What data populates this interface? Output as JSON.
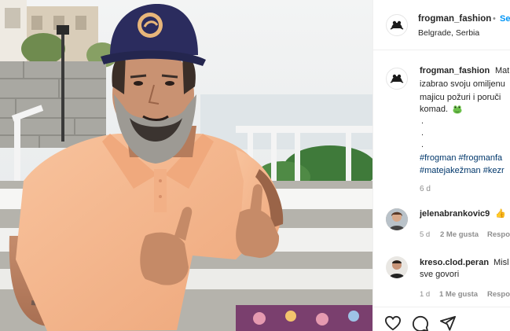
{
  "header": {
    "username": "frogman_fashion",
    "dot": "•",
    "follow": "Se",
    "location": "Belgrade, Serbia"
  },
  "caption": {
    "username": "frogman_fashion",
    "line1_end": "Mat",
    "line2": "izabrao svoju omiljenu",
    "line3": "majicu požuri i poruči",
    "line4": "komad.",
    "dot1": ".",
    "dot2": ".",
    "dot3": ".",
    "tags1": "#frogman #frogmanfa",
    "tags2": "#matejakežman #kezr",
    "time": "6 d"
  },
  "comments": [
    {
      "username": "jelenabrankovic9",
      "text": "👍",
      "time": "5 d",
      "likes": "2 Me gusta",
      "reply": "Respo"
    },
    {
      "username": "kreso.clod.peran",
      "text": "Misl",
      "text2": "sve govori",
      "time": "1 d",
      "likes": "1 Me gusta",
      "reply": "Respo"
    }
  ],
  "actions": {
    "like_icon": "heart-icon",
    "comment_icon": "comment-icon",
    "share_icon": "share-icon"
  },
  "photo": {
    "cap_logo": "FROGMAN"
  },
  "colors": {
    "shirt": "#f5b890",
    "cap": "#2b2c5e",
    "tag": "#00376b",
    "link": "#0095f6"
  }
}
